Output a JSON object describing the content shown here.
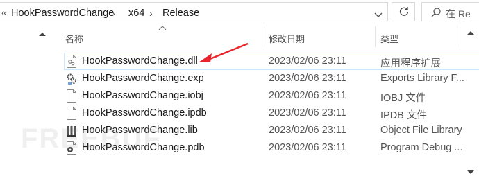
{
  "breadcrumb": {
    "lead": "«",
    "segments": [
      "HookPasswordChange",
      "x64",
      "Release"
    ],
    "separator": "›"
  },
  "search": {
    "placeholder": "在 Re"
  },
  "columns": {
    "name": "名称",
    "date": "修改日期",
    "type": "类型"
  },
  "files": [
    {
      "name": "HookPasswordChange.dll",
      "date": "2023/02/06 23:11",
      "type": "应用程序扩展",
      "icon": "dll-icon"
    },
    {
      "name": "HookPasswordChange.exp",
      "date": "2023/02/06 23:11",
      "type": "Exports Library F...",
      "icon": "exp-icon"
    },
    {
      "name": "HookPasswordChange.iobj",
      "date": "2023/02/06 23:11",
      "type": "IOBJ 文件",
      "icon": "file-icon"
    },
    {
      "name": "HookPasswordChange.ipdb",
      "date": "2023/02/06 23:11",
      "type": "IPDB 文件",
      "icon": "file-icon"
    },
    {
      "name": "HookPasswordChange.lib",
      "date": "2023/02/06 23:11",
      "type": "Object File Library",
      "icon": "lib-icon"
    },
    {
      "name": "HookPasswordChange.pdb",
      "date": "2023/02/06 23:11",
      "type": "Program Debug ...",
      "icon": "pdb-icon"
    }
  ],
  "watermark": "FREEBUF",
  "colors": {
    "arrow": "#e8232b",
    "selection_border": "#cde8ff",
    "divider": "#e5e5e5"
  }
}
